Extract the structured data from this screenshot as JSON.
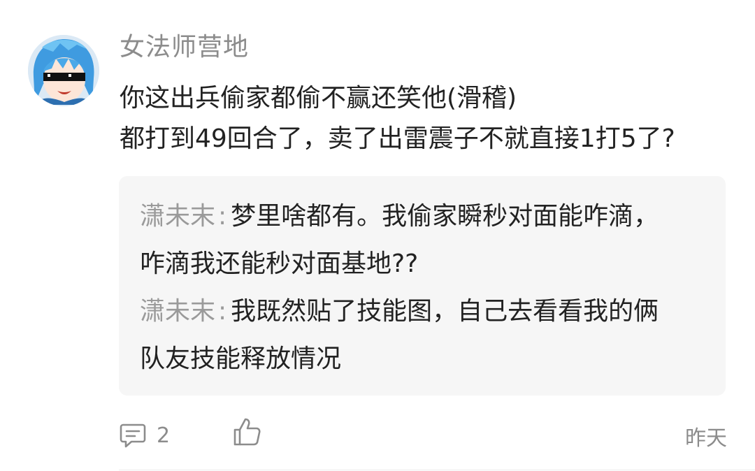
{
  "comment": {
    "username": "女法师营地",
    "body_lines": [
      "你这出兵偷家都偷不赢还笑他(滑稽)",
      "都打到49回合了，卖了出雷震子不就直接1打5了?"
    ]
  },
  "replies": [
    {
      "author": "潇未末",
      "colon": ":",
      "lines": [
        "梦里啥都有。我偷家瞬秒对面能咋滴，",
        "咋滴我还能秒对面基地??"
      ]
    },
    {
      "author": "潇未末",
      "colon": ":",
      "lines": [
        "我既然贴了技能图，自己去看看我的俩",
        "队友技能释放情况"
      ]
    }
  ],
  "actions": {
    "reply_icon": "comment-bubble-icon",
    "reply_count": "2",
    "like_icon": "thumbs-up-icon",
    "timestamp": "昨天"
  },
  "colors": {
    "username": "#8c8c8c",
    "text": "#222222",
    "reply_author": "#9a9a9a",
    "reply_background": "#f6f6f6",
    "icon": "#8c8c8c"
  }
}
